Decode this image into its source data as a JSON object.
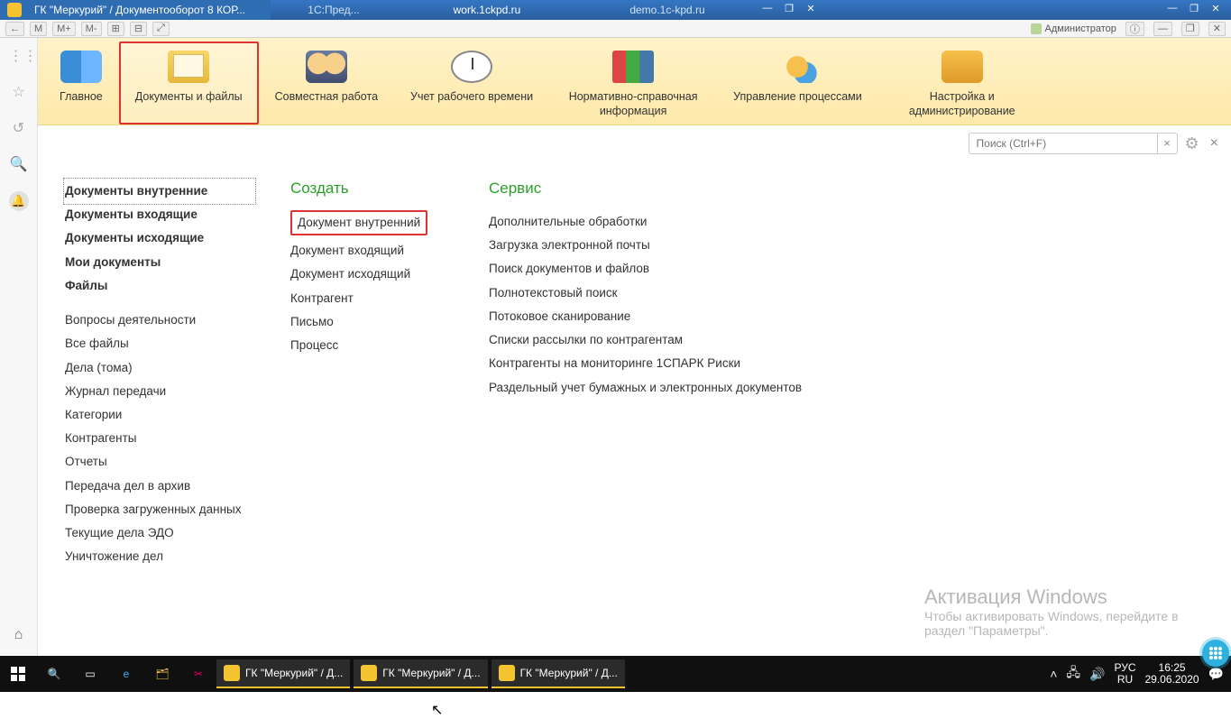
{
  "titlebars": [
    {
      "icon": "app",
      "text": "ГК \"Меркурий\" / Документооборот 8 КОР..."
    },
    {
      "text": "1С:Пред..."
    },
    {
      "text": "work.1ckpd.ru"
    },
    {
      "text": "demo.1c-kpd.ru"
    }
  ],
  "secondbar": {
    "items": [
      "←",
      "★",
      "M",
      "M+",
      "M-",
      "⊞",
      "⊟",
      "⤢"
    ],
    "user_label": "Администратор"
  },
  "leftbar": {
    "grid": "⋮⋮⋮",
    "star": "☆",
    "history": "↺",
    "search": "🔍",
    "bell": "🔔",
    "home": "⌂"
  },
  "ribbon": [
    {
      "id": "main",
      "label": "Главное",
      "icon": "ico-lamp"
    },
    {
      "id": "docs",
      "label": "Документы и файлы",
      "icon": "ico-folder",
      "selected": true
    },
    {
      "id": "collab",
      "label": "Совместная работа",
      "icon": "ico-people"
    },
    {
      "id": "timesheet",
      "label": "Учет рабочего времени",
      "icon": "ico-clock"
    },
    {
      "id": "refinfo",
      "label": "Нормативно-справочная информация",
      "icon": "ico-books"
    },
    {
      "id": "proc",
      "label": "Управление процессами",
      "icon": "ico-gears"
    },
    {
      "id": "admin",
      "label": "Настройка и администрирование",
      "icon": "ico-db"
    }
  ],
  "search_placeholder": "Поиск (Ctrl+F)",
  "columns": {
    "nav": {
      "primary": [
        {
          "label": "Документы внутренние",
          "active": true
        },
        {
          "label": "Документы входящие"
        },
        {
          "label": "Документы исходящие"
        },
        {
          "label": "Мои документы"
        },
        {
          "label": "Файлы"
        }
      ],
      "secondary": [
        "Вопросы деятельности",
        "Все файлы",
        "Дела (тома)",
        "Журнал передачи",
        "Категории",
        "Контрагенты",
        "Отчеты",
        "Передача дел в архив",
        "Проверка загруженных данных",
        "Текущие дела ЭДО",
        "Уничтожение дел"
      ]
    },
    "create": {
      "header": "Создать",
      "items": [
        {
          "label": "Документ внутренний",
          "boxed": true
        },
        {
          "label": "Документ входящий"
        },
        {
          "label": "Документ исходящий"
        },
        {
          "label": "Контрагент"
        },
        {
          "label": "Письмо"
        },
        {
          "label": "Процесс"
        }
      ]
    },
    "service": {
      "header": "Сервис",
      "items": [
        "Дополнительные обработки",
        "Загрузка электронной почты",
        "Поиск документов и файлов",
        "Полнотекстовый поиск",
        "Потоковое сканирование",
        "Списки рассылки по контрагентам",
        "Контрагенты на мониторинге 1СПАРК Риски",
        "Раздельный учет бумажных и электронных документов"
      ]
    }
  },
  "watermark": {
    "title": "Активация Windows",
    "text": "Чтобы активировать Windows, перейдите в раздел \"Параметры\"."
  },
  "taskbar": {
    "entries": [
      {
        "label": "ГК \"Меркурий\" / Д..."
      },
      {
        "label": "ГК \"Меркурий\" / Д..."
      },
      {
        "label": "ГК \"Меркурий\" / Д..."
      }
    ],
    "lang_top": "РУС",
    "lang_bottom": "RU",
    "time": "16:25",
    "date": "29.06.2020"
  }
}
